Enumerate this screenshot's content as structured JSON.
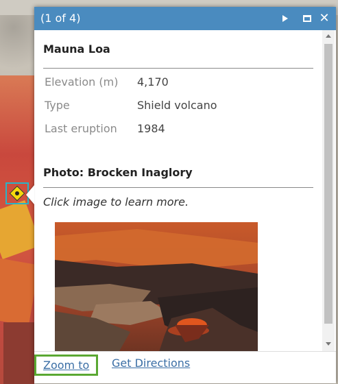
{
  "popup": {
    "page_count": "(1 of 4)",
    "controls": {
      "next_icon": "triangle-right-icon",
      "maximize_icon": "maximize-icon",
      "close_icon": "close-icon",
      "close_glyph": "✕"
    },
    "feature_title": "Mauna Loa",
    "attributes": [
      {
        "label": "Elevation (m)",
        "value": "4,170"
      },
      {
        "label": "Type",
        "value": "Shield volcano"
      },
      {
        "label": "Last eruption",
        "value": "1984"
      }
    ],
    "photo_heading": "Photo: Brocken Inaglory",
    "caption": "Click image to learn more.",
    "actions": {
      "zoom_to": "Zoom to",
      "get_directions": "Get Directions"
    }
  },
  "colors": {
    "titlebar": "#4a8bbf",
    "link": "#3a6ea5",
    "focus_outline": "#5aa832",
    "marker_outline": "#27b5c8",
    "marker_fill": "#f5d80c"
  }
}
